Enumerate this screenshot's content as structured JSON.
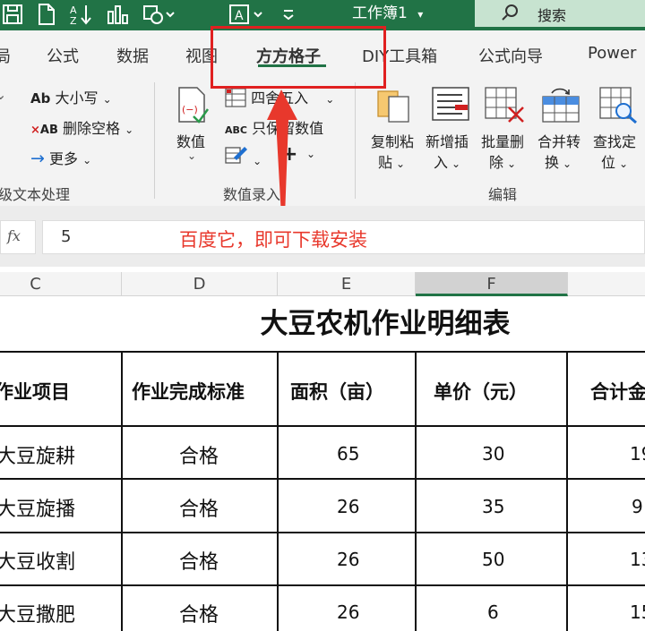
{
  "qat": {
    "icons": [
      "save-icon",
      "new-document-icon",
      "sort-ascending-icon",
      "bar-chart-icon",
      "shapes-icon",
      "text-box-icon",
      "customize-icon"
    ],
    "document_title": "工作簿1",
    "search_label": "搜索"
  },
  "ribbon": {
    "tabs": [
      "局",
      "公式",
      "数据",
      "视图",
      "方方格子",
      "DIY工具箱",
      "公式向导",
      "Power"
    ],
    "active_tab": "方方格子",
    "text_group": {
      "items": [
        "大小写",
        "删除空格",
        "更多"
      ],
      "group_label": "级文本处理"
    },
    "entry_group": {
      "large_label": "数值",
      "items": [
        "四舍五入",
        "只保留数值"
      ],
      "group_label": "数值录入"
    },
    "edit_group": {
      "buttons": [
        {
          "line1": "复制粘",
          "line2": "贴"
        },
        {
          "line1": "新增插",
          "line2": "入"
        },
        {
          "line1": "批量删",
          "line2": "除"
        },
        {
          "line1": "合并转",
          "line2": "换"
        },
        {
          "line1": "查找定",
          "line2": "位"
        }
      ],
      "group_label": "编辑"
    }
  },
  "formula_bar": {
    "fx_label": "fx",
    "value": "5",
    "annotation": "百度它，即可下载安装"
  },
  "sheet": {
    "columns": [
      "C",
      "D",
      "E",
      "F"
    ],
    "selected_column": "F",
    "title": "大豆农机作业明细表",
    "headers": [
      "作业项目",
      "作业完成标准",
      "面积（亩）",
      "单价（元）",
      "合计金"
    ],
    "rows": [
      [
        "大豆旋耕",
        "合格",
        "65",
        "30",
        "19"
      ],
      [
        "大豆旋播",
        "合格",
        "26",
        "35",
        "9"
      ],
      [
        "大豆收割",
        "合格",
        "26",
        "50",
        "13"
      ],
      [
        "大豆撒肥",
        "合格",
        "26",
        "6",
        "15"
      ]
    ]
  },
  "colors": {
    "title_bar": "#217346",
    "annotation": "#e8382c",
    "highlight_box": "#e02020"
  }
}
